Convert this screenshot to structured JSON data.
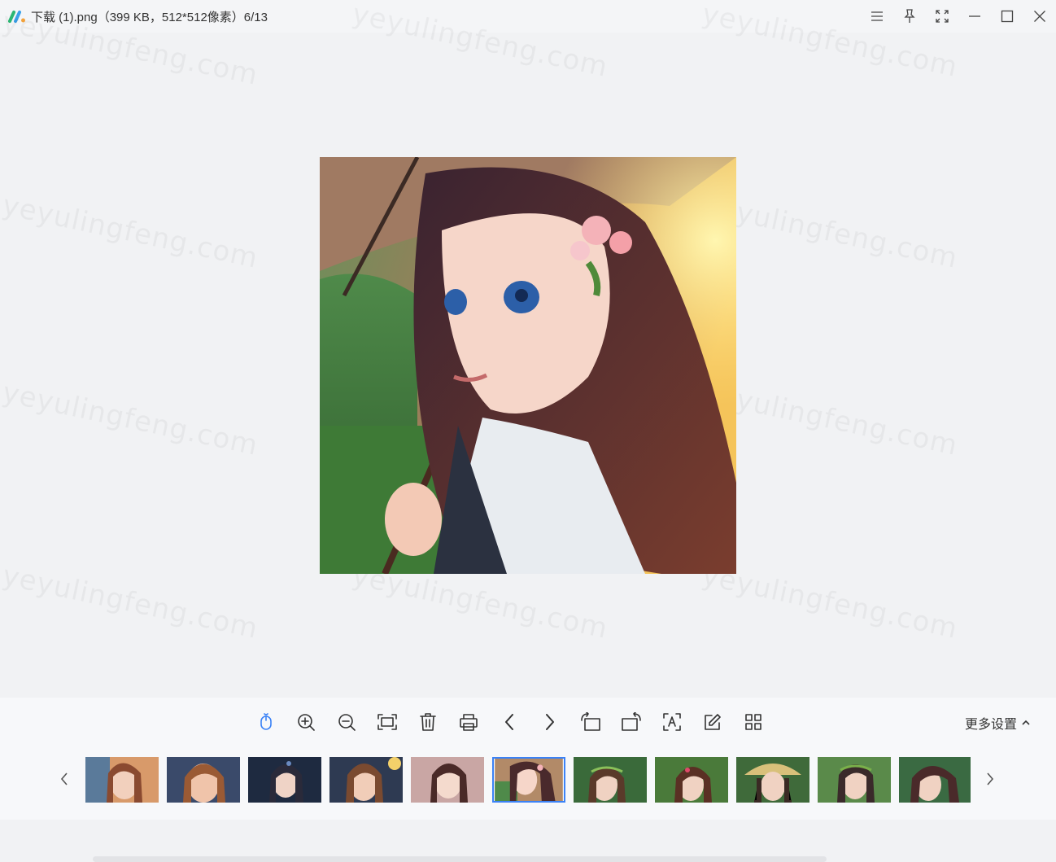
{
  "window": {
    "title": "下载 (1).png（399 KB，512*512像素）6/13",
    "controls": [
      "menu-icon",
      "pin-icon",
      "fullscreen-icon",
      "minimize-icon",
      "maximize-icon",
      "close-icon"
    ]
  },
  "watermark_text": "yeyulingfeng.com",
  "main_image": {
    "alt": "anime girl with umbrella"
  },
  "toolbar": {
    "tools": [
      "mouse-mode-icon",
      "zoom-in-icon",
      "zoom-out-icon",
      "fit-screen-icon",
      "delete-icon",
      "print-icon",
      "prev-icon",
      "next-icon",
      "rotate-left-icon",
      "rotate-right-icon",
      "ocr-icon",
      "edit-icon",
      "grid-view-icon"
    ],
    "more_settings_label": "更多设置"
  },
  "thumbnails": {
    "count": 11,
    "active_index": 5
  },
  "colors": {
    "accent": "#3b82f6",
    "background": "#f1f2f4"
  }
}
